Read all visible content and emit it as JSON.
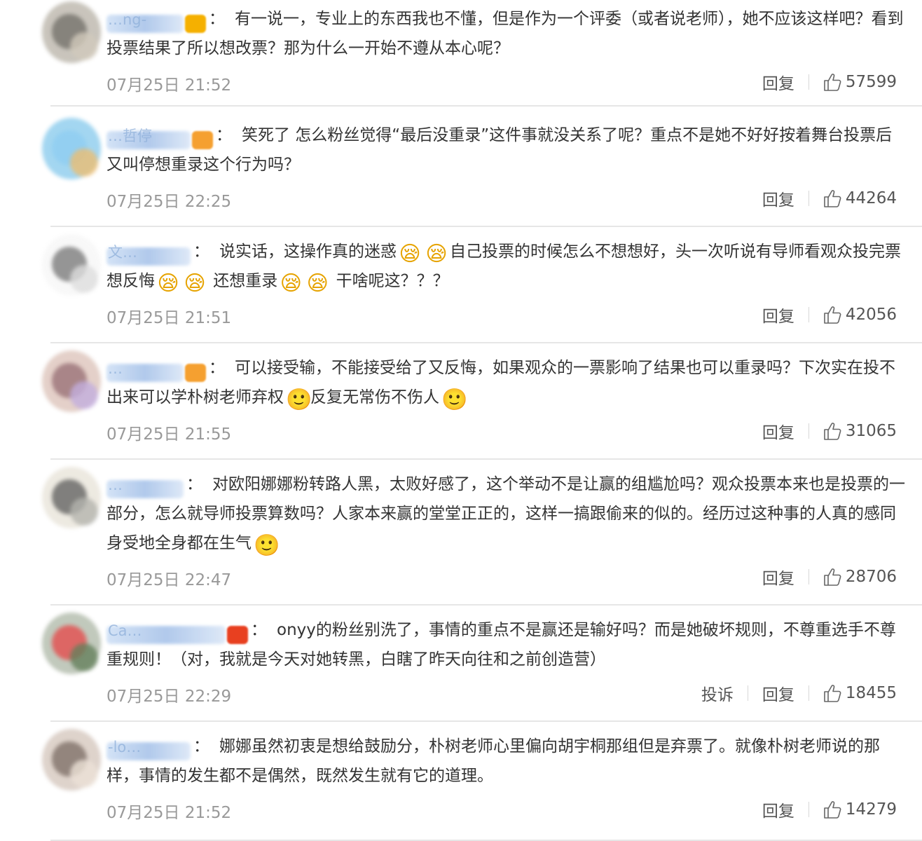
{
  "labels": {
    "reply": "回复",
    "report": "投诉"
  },
  "colors": {
    "text": "#333333",
    "time": "#999999",
    "action": "#555555",
    "divider": "#e6e6e6",
    "username_blur": "#a9c4ea"
  },
  "comments": [
    {
      "user": "…ng-",
      "badge": "crown",
      "text_parts": [
        "有一说一，专业上的东西我也不懂，但是作为一个评委（或者说老师），她不应该这样吧？看到投票结果了所以想改票？那为什么一开始不遵从本心呢？"
      ],
      "time": "07月25日 21:52",
      "likes": "57599",
      "show_report": false
    },
    {
      "user": "…哲停",
      "badge": "orange",
      "text_parts": [
        "笑死了 怎么粉丝觉得“最后没重录”这件事就没关系了呢？重点不是她不好好按着舞台投票后 又叫停想重录这个行为吗？"
      ],
      "time": "07月25日 22:25",
      "likes": "44264",
      "show_report": false
    },
    {
      "user": "文…",
      "badge": "",
      "text_parts": [
        "说实话，这操作真的迷惑",
        "E:sleepy",
        "E:sleepy",
        "自己投票的时候怎么不想想好，头一次听说有导师看观众投完票想反悔",
        "E:sleepy",
        "E:sleepy",
        " 还想重录",
        "E:sleepy",
        "E:sleepy",
        " 干啥呢这？？？"
      ],
      "time": "07月25日 21:51",
      "likes": "42056",
      "show_report": false
    },
    {
      "user": "…",
      "badge": "orange",
      "text_parts": [
        "可以接受输，不能接受给了又反悔，如果观众的一票影响了结果也可以重录吗？下次实在投不出来可以学朴树老师弃权",
        "E:smile",
        "反复无常伤不伤人",
        "E:smile"
      ],
      "time": "07月25日 21:55",
      "likes": "31065",
      "show_report": false
    },
    {
      "user": "…",
      "badge": "",
      "text_parts": [
        "对欧阳娜娜粉转路人黑，太败好感了，这个举动不是让赢的组尴尬吗？观众投票本来也是投票的一部分，怎么就导师投票算数吗？人家本来赢的堂堂正正的，这样一搞跟偷来的似的。经历过这种事的人真的感同身受地全身都在生气",
        "E:smile"
      ],
      "time": "07月25日 22:47",
      "likes": "28706",
      "show_report": false
    },
    {
      "user": "Ca…",
      "badge": "red",
      "text_parts": [
        "onyy的粉丝别洗了，事情的重点不是赢还是输好吗？而是她破坏规则，不尊重选手不尊重规则！（对，我就是今天对她转黑，白瞎了昨天向往和之前创造营）"
      ],
      "time": "07月25日 22:29",
      "likes": "18455",
      "show_report": true
    },
    {
      "user": "-lo…",
      "badge": "",
      "text_parts": [
        "娜娜虽然初衷是想给鼓励分，朴树老师心里偏向胡宇桐那组但是弃票了。就像朴树老师说的那样，事情的发生都不是偶然，既然发生就有它的道理。"
      ],
      "time": "07月25日 21:52",
      "likes": "14279",
      "show_report": false
    }
  ]
}
